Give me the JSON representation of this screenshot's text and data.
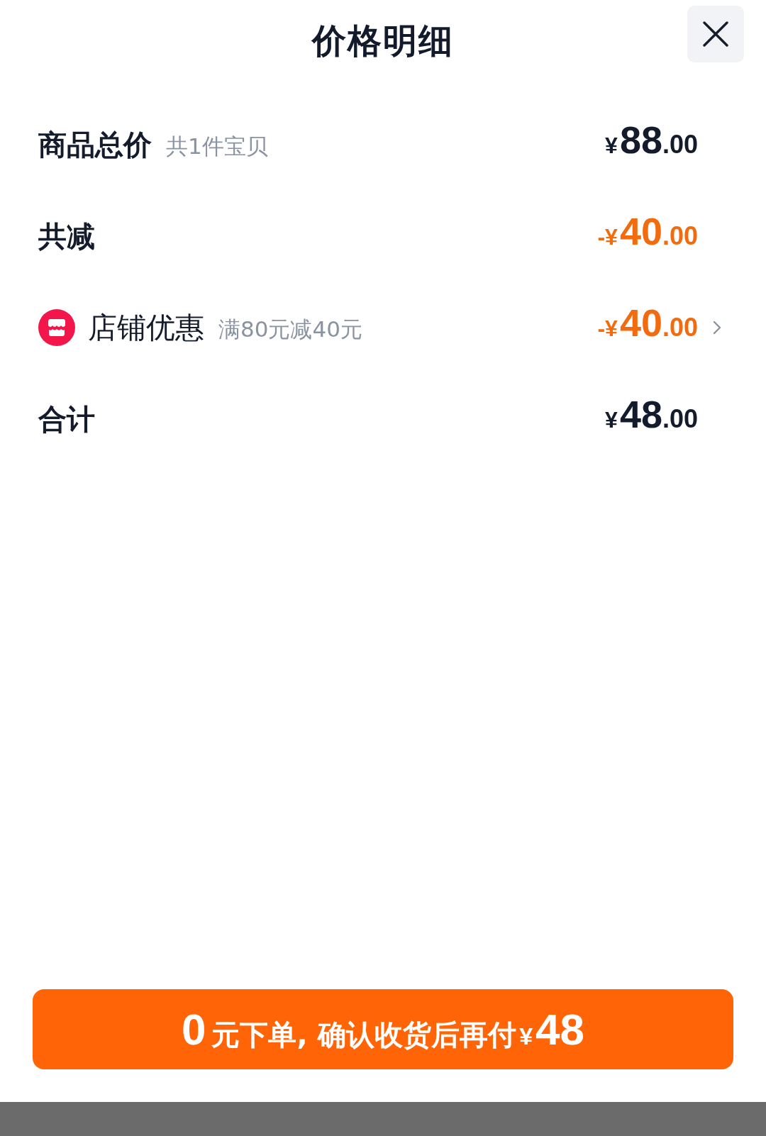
{
  "header": {
    "title": "价格明细"
  },
  "rows": [
    {
      "kind": "summary",
      "label": "商品总价",
      "note": "共1件宝贝",
      "discount": false,
      "amount": {
        "prefix": "¥",
        "integer": "88",
        "decimal": ".00"
      }
    },
    {
      "kind": "summary",
      "label": "共减",
      "discount": true,
      "amount": {
        "prefix": "-¥",
        "integer": "40",
        "decimal": ".00"
      }
    },
    {
      "kind": "coupon",
      "label": "店铺优惠",
      "note": "满80元减40元",
      "discount": true,
      "amount": {
        "prefix": "-¥",
        "integer": "40",
        "decimal": ".00"
      }
    },
    {
      "kind": "summary",
      "label": "合计",
      "discount": false,
      "amount": {
        "prefix": "¥",
        "integer": "48",
        "decimal": ".00"
      }
    }
  ],
  "checkout_button": {
    "lead": "0",
    "text": "元下单, 确认收货后再付",
    "currency": "¥",
    "amount": "48"
  }
}
